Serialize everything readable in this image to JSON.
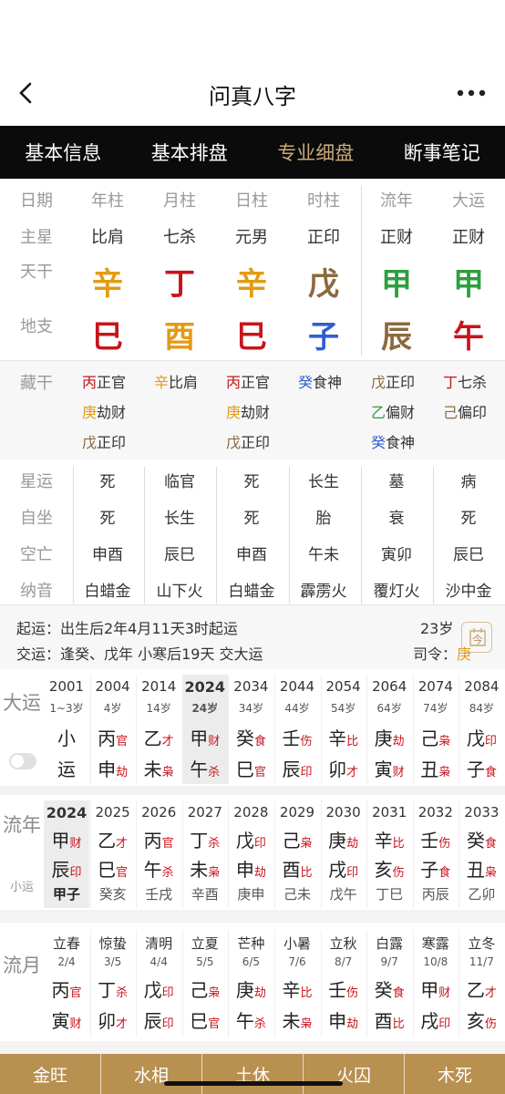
{
  "header": {
    "title": "问真八字"
  },
  "tabs": [
    {
      "label": "基本信息",
      "active": false
    },
    {
      "label": "基本排盘",
      "active": false
    },
    {
      "label": "专业细盘",
      "active": true
    },
    {
      "label": "断事笔记",
      "active": false
    }
  ],
  "pillars": {
    "headers": [
      "日期",
      "年柱",
      "月柱",
      "日柱",
      "时柱",
      "流年",
      "大运"
    ],
    "row_star_label": "主星",
    "stars": [
      "比肩",
      "七杀",
      "元男",
      "正印",
      "正财",
      "正财"
    ],
    "row_gan_label": "天干",
    "gan": [
      "辛",
      "丁",
      "辛",
      "戊",
      "甲",
      "甲"
    ],
    "row_zhi_label": "地支",
    "zhi": [
      "巳",
      "酉",
      "巳",
      "子",
      "辰",
      "午"
    ]
  },
  "canggan": {
    "label": "藏干",
    "cols": [
      [
        [
          "丙",
          "正官"
        ],
        [
          "庚",
          "劫财"
        ],
        [
          "戊",
          "正印"
        ]
      ],
      [
        [
          "辛",
          "比肩"
        ]
      ],
      [
        [
          "丙",
          "正官"
        ],
        [
          "庚",
          "劫财"
        ],
        [
          "戊",
          "正印"
        ]
      ],
      [
        [
          "癸",
          "食神"
        ]
      ],
      [
        [
          "戊",
          "正印"
        ],
        [
          "乙",
          "偏财"
        ],
        [
          "癸",
          "食神"
        ]
      ],
      [
        [
          "丁",
          "七杀"
        ],
        [
          "己",
          "偏印"
        ]
      ]
    ]
  },
  "details": {
    "rows": [
      {
        "label": "星运",
        "values": [
          "死",
          "临官",
          "死",
          "长生",
          "墓",
          "病"
        ]
      },
      {
        "label": "自坐",
        "values": [
          "死",
          "长生",
          "死",
          "胎",
          "衰",
          "死"
        ]
      },
      {
        "label": "空亡",
        "values": [
          "申酉",
          "辰巳",
          "申酉",
          "午未",
          "寅卯",
          "辰巳"
        ]
      },
      {
        "label": "纳音",
        "values": [
          "白蜡金",
          "山下火",
          "白蜡金",
          "霹雳火",
          "覆灯火",
          "沙中金"
        ]
      }
    ]
  },
  "yun": {
    "qiyun": "起运：出生后2年4月11天3时起运",
    "jiaoyun": "交运：逢癸、戊年 小寒后19天 交大运",
    "age": "23岁",
    "siling_label": "司令：",
    "siling_value": "庚",
    "cal_icon_text": "今"
  },
  "dayun": {
    "label": "大运",
    "cols": [
      {
        "year": "2001",
        "age": "1~3岁",
        "g": "小",
        "gt": "",
        "z": "运",
        "zt": ""
      },
      {
        "year": "2004",
        "age": "4岁",
        "g": "丙",
        "gt": "官",
        "z": "申",
        "zt": "劫"
      },
      {
        "year": "2014",
        "age": "14岁",
        "g": "乙",
        "gt": "才",
        "z": "未",
        "zt": "枭"
      },
      {
        "year": "2024",
        "age": "24岁",
        "g": "甲",
        "gt": "财",
        "z": "午",
        "zt": "杀"
      },
      {
        "year": "2034",
        "age": "34岁",
        "g": "癸",
        "gt": "食",
        "z": "巳",
        "zt": "官"
      },
      {
        "year": "2044",
        "age": "44岁",
        "g": "壬",
        "gt": "伤",
        "z": "辰",
        "zt": "印"
      },
      {
        "year": "2054",
        "age": "54岁",
        "g": "辛",
        "gt": "比",
        "z": "卯",
        "zt": "才"
      },
      {
        "year": "2064",
        "age": "64岁",
        "g": "庚",
        "gt": "劫",
        "z": "寅",
        "zt": "财"
      },
      {
        "year": "2074",
        "age": "74岁",
        "g": "己",
        "gt": "枭",
        "z": "丑",
        "zt": "枭"
      },
      {
        "year": "2084",
        "age": "84岁",
        "g": "戊",
        "gt": "印",
        "z": "子",
        "zt": "食"
      }
    ]
  },
  "liunian": {
    "label": "流年",
    "sub": "小运",
    "cols": [
      {
        "year": "2024",
        "g": "甲",
        "gt": "财",
        "z": "辰",
        "zt": "印",
        "x": "甲子"
      },
      {
        "year": "2025",
        "g": "乙",
        "gt": "才",
        "z": "巳",
        "zt": "官",
        "x": "癸亥"
      },
      {
        "year": "2026",
        "g": "丙",
        "gt": "官",
        "z": "午",
        "zt": "杀",
        "x": "壬戌"
      },
      {
        "year": "2027",
        "g": "丁",
        "gt": "杀",
        "z": "未",
        "zt": "枭",
        "x": "辛酉"
      },
      {
        "year": "2028",
        "g": "戊",
        "gt": "印",
        "z": "申",
        "zt": "劫",
        "x": "庚申"
      },
      {
        "year": "2029",
        "g": "己",
        "gt": "枭",
        "z": "酉",
        "zt": "比",
        "x": "己未"
      },
      {
        "year": "2030",
        "g": "庚",
        "gt": "劫",
        "z": "戌",
        "zt": "印",
        "x": "戊午"
      },
      {
        "year": "2031",
        "g": "辛",
        "gt": "比",
        "z": "亥",
        "zt": "伤",
        "x": "丁巳"
      },
      {
        "year": "2032",
        "g": "壬",
        "gt": "伤",
        "z": "子",
        "zt": "食",
        "x": "丙辰"
      },
      {
        "year": "2033",
        "g": "癸",
        "gt": "食",
        "z": "丑",
        "zt": "枭",
        "x": "乙卯"
      }
    ]
  },
  "liuyue": {
    "label": "流月",
    "cols": [
      {
        "jie": "立春",
        "date": "2/4",
        "g": "丙",
        "gt": "官",
        "z": "寅",
        "zt": "财"
      },
      {
        "jie": "惊蛰",
        "date": "3/5",
        "g": "丁",
        "gt": "杀",
        "z": "卯",
        "zt": "才"
      },
      {
        "jie": "清明",
        "date": "4/4",
        "g": "戊",
        "gt": "印",
        "z": "辰",
        "zt": "印"
      },
      {
        "jie": "立夏",
        "date": "5/5",
        "g": "己",
        "gt": "枭",
        "z": "巳",
        "zt": "官"
      },
      {
        "jie": "芒种",
        "date": "6/5",
        "g": "庚",
        "gt": "劫",
        "z": "午",
        "zt": "杀"
      },
      {
        "jie": "小暑",
        "date": "7/6",
        "g": "辛",
        "gt": "比",
        "z": "未",
        "zt": "枭"
      },
      {
        "jie": "立秋",
        "date": "8/7",
        "g": "壬",
        "gt": "伤",
        "z": "申",
        "zt": "劫"
      },
      {
        "jie": "白露",
        "date": "9/7",
        "g": "癸",
        "gt": "食",
        "z": "酉",
        "zt": "比"
      },
      {
        "jie": "寒露",
        "date": "10/8",
        "g": "甲",
        "gt": "财",
        "z": "戌",
        "zt": "印"
      },
      {
        "jie": "立冬",
        "date": "11/7",
        "g": "乙",
        "gt": "才",
        "z": "亥",
        "zt": "伤"
      }
    ]
  },
  "wuxing": [
    "金旺",
    "水相",
    "土休",
    "火囚",
    "木死"
  ],
  "colors": {
    "wood": "#2e9e3e",
    "fire": "#c8141c",
    "earth": "#8a6a3c",
    "metal": "#e39a14",
    "water": "#2f5fd0",
    "accent": "#c9a97a",
    "bottom_bar": "#b89050"
  }
}
